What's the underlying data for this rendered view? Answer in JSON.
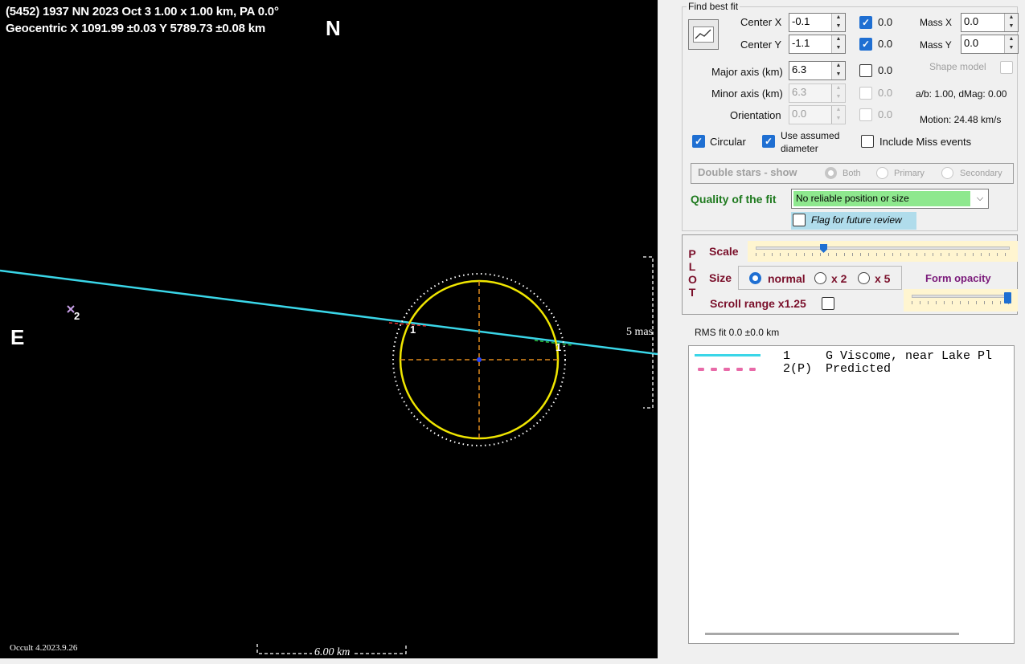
{
  "plot": {
    "header_line1": "(5452) 1937 NN  2023 Oct 3   1.00 x 1.00 km, PA 0.0°",
    "header_line2": "Geocentric  X  1091.99 ±0.03  Y 5789.73 ±0.08 km",
    "north_label": "N",
    "east_label": "E",
    "chord_label_1": "1",
    "chord_label_1b": "1",
    "star_label": "2",
    "scale_mas_label": "5 mas",
    "scale_km_label": "6.00 km",
    "version_label": "Occult 4.2023.9.26",
    "colors": {
      "background": "#000000",
      "chord": "#3ad6e8",
      "ellipse": "#f0e600",
      "predicted": "#ffffff",
      "axes": "#e08a1e"
    }
  },
  "panel": {
    "find_best_fit_title": "Find best fit",
    "center_x": {
      "label": "Center X",
      "value": "-0.1",
      "check_value": "0.0",
      "checked": true
    },
    "center_y": {
      "label": "Center Y",
      "value": "-1.1",
      "check_value": "0.0",
      "checked": true
    },
    "mass_x": {
      "label": "Mass X",
      "value": "0.0"
    },
    "mass_y": {
      "label": "Mass Y",
      "value": "0.0"
    },
    "shape_model_label": "Shape model",
    "major_axis": {
      "label": "Major axis (km)",
      "value": "6.3",
      "check_value": "0.0"
    },
    "minor_axis": {
      "label": "Minor axis (km)",
      "value": "6.3",
      "check_value": "0.0"
    },
    "orientation": {
      "label": "Orientation",
      "value": "0.0",
      "check_value": "0.0"
    },
    "ab_dmag": "a/b: 1.00, dMag: 0.00",
    "motion": "Motion: 24.48 km/s",
    "circular_label": "Circular",
    "use_assumed_line1": "Use assumed",
    "use_assumed_line2": "diameter",
    "include_miss_label": "Include Miss events",
    "double_stars_title": "Double stars - show",
    "double_both": "Both",
    "double_primary": "Primary",
    "double_secondary": "Secondary",
    "quality_label": "Quality of the fit",
    "quality_value": "No reliable position or size",
    "flag_label": "Flag for future review",
    "plot_letters": [
      "P",
      "L",
      "O",
      "T"
    ],
    "scale_label": "Scale",
    "size_label": "Size",
    "size_normal": "normal",
    "size_x2": "x 2",
    "size_x5": "x 5",
    "form_opacity_label": "Form opacity",
    "scroll_range_label": "Scroll range x1.25",
    "rms_fit": "RMS fit 0.0 ±0.0 km",
    "legend": [
      {
        "num": "1",
        "text": "G Viscome, near Lake Pl",
        "color": "#3ad6e8",
        "style": "solid"
      },
      {
        "num": "2(P)",
        "text": "Predicted",
        "color": "#e86aa8",
        "style": "dotted"
      }
    ]
  }
}
